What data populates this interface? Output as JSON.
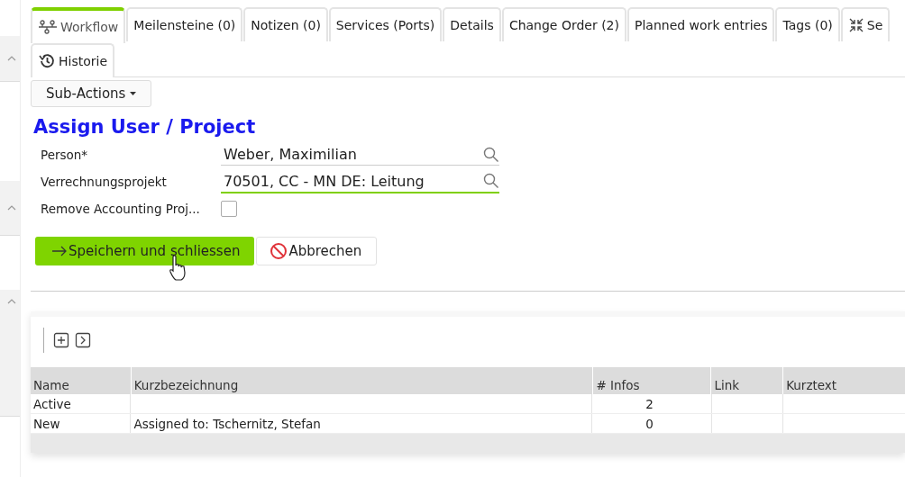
{
  "tabs": [
    {
      "label": "Workflow",
      "kind": "workflow",
      "selected": true
    },
    {
      "label": "Meilensteine (0)",
      "selected": false
    },
    {
      "label": "Notizen (0)",
      "selected": false
    },
    {
      "label": "Services (Ports)",
      "selected": false
    },
    {
      "label": "Details",
      "selected": false
    },
    {
      "label": "Change Order (2)",
      "selected": false
    },
    {
      "label": "Planned work entries",
      "selected": false
    },
    {
      "label": "Tags (0)",
      "selected": false
    },
    {
      "label": "Se",
      "kind": "collapse",
      "selected": false
    },
    {
      "label": "Historie",
      "kind": "history",
      "selected": false
    }
  ],
  "sub_actions": "Sub-Actions",
  "form": {
    "title": "Assign User / Project",
    "fields": [
      {
        "kind": "lookup",
        "label": "Person*",
        "value": "Weber, Maximilian",
        "focused": false
      },
      {
        "kind": "lookup",
        "label": "Verrechnungsprojekt",
        "value": "70501, CC - MN DE: Leitung",
        "focused": true
      },
      {
        "kind": "checkbox",
        "label": "Remove Accounting Proj...",
        "checked": false
      }
    ],
    "buttons": [
      {
        "kind": "save",
        "label": "Speichern und schliessen"
      },
      {
        "kind": "cancel",
        "label": "Abbrechen"
      }
    ]
  },
  "table": {
    "columns": [
      "Name",
      "Kurzbezeichnung",
      "# Infos",
      "Link",
      "Kurztext"
    ],
    "rows": [
      [
        "Active",
        "",
        "2",
        "",
        ""
      ],
      [
        "New",
        "Assigned to: Tschernitz, Stefan",
        "0",
        "",
        ""
      ]
    ]
  }
}
